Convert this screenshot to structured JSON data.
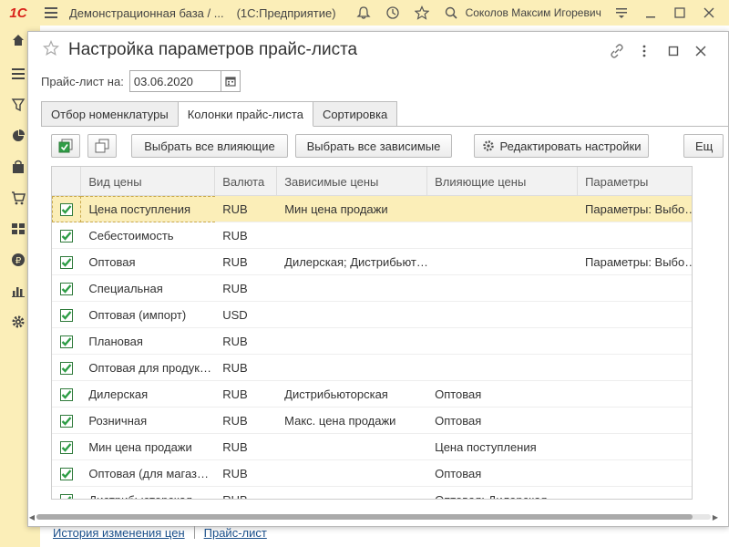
{
  "topbar": {
    "logo": "1С",
    "title": "Демонстрационная база / ...",
    "platform": "(1С:Предприятие)",
    "user": "Соколов Максим Игоревич"
  },
  "window": {
    "title": "Настройка параметров прайс-листа",
    "date_label": "Прайс-лист на:",
    "date_value": "03.06.2020"
  },
  "tabs": [
    {
      "label": "Отбор номенклатуры",
      "active": false
    },
    {
      "label": "Колонки прайс-листа",
      "active": true
    },
    {
      "label": "Сортировка",
      "active": false
    }
  ],
  "toolbar": {
    "select_influencing": "Выбрать все влияющие",
    "select_dependent": "Выбрать все зависимые",
    "edit_settings": "Редактировать настройки",
    "more": "Ещ"
  },
  "table": {
    "headers": [
      "Вид цены",
      "Валюта",
      "Зависимые цены",
      "Влияющие цены",
      "Параметры"
    ],
    "rows": [
      {
        "checked": true,
        "name": "Цена поступления",
        "currency": "RUB",
        "dependent": "Мин цена продажи",
        "influencing": "",
        "params": "Параметры: Выбо…"
      },
      {
        "checked": true,
        "name": "Себестоимость",
        "currency": "RUB",
        "dependent": "",
        "influencing": "",
        "params": ""
      },
      {
        "checked": true,
        "name": "Оптовая",
        "currency": "RUB",
        "dependent": "Дилерская; Дистрибьют…",
        "influencing": "",
        "params": "Параметры: Выбо…"
      },
      {
        "checked": true,
        "name": "Специальная",
        "currency": "RUB",
        "dependent": "",
        "influencing": "",
        "params": ""
      },
      {
        "checked": true,
        "name": "Оптовая (импорт)",
        "currency": "USD",
        "dependent": "",
        "influencing": "",
        "params": ""
      },
      {
        "checked": true,
        "name": "Плановая",
        "currency": "RUB",
        "dependent": "",
        "influencing": "",
        "params": ""
      },
      {
        "checked": true,
        "name": "Оптовая для продук…",
        "currency": "RUB",
        "dependent": "",
        "influencing": "",
        "params": ""
      },
      {
        "checked": true,
        "name": "Дилерская",
        "currency": "RUB",
        "dependent": "Дистрибьюторская",
        "influencing": "Оптовая",
        "params": ""
      },
      {
        "checked": true,
        "name": "Розничная",
        "currency": "RUB",
        "dependent": "Макс. цена продажи",
        "influencing": "Оптовая",
        "params": ""
      },
      {
        "checked": true,
        "name": "Мин цена продажи",
        "currency": "RUB",
        "dependent": "",
        "influencing": "Цена поступления",
        "params": ""
      },
      {
        "checked": true,
        "name": "Оптовая (для магаз…",
        "currency": "RUB",
        "dependent": "",
        "influencing": "Оптовая",
        "params": ""
      },
      {
        "checked": true,
        "name": "Дистрибьюторская",
        "currency": "RUB",
        "dependent": "",
        "influencing": "Оптовая; Дилерская",
        "params": ""
      }
    ]
  },
  "links": {
    "history": "История изменения цен",
    "pricelist": "Прайс-лист"
  },
  "colors": {
    "accent_bg": "#fbeeb8",
    "checkbox_green": "#2e9e46",
    "link": "#1a4f8a"
  }
}
